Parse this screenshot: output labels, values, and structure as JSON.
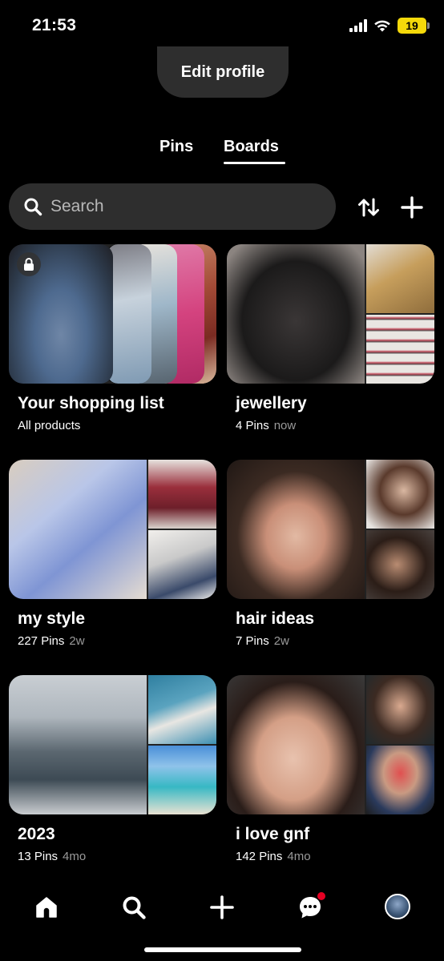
{
  "status_bar": {
    "time": "21:53",
    "battery": "19",
    "icons": [
      "cellular-signal-icon",
      "wifi-icon",
      "battery-icon"
    ]
  },
  "profile": {
    "edit_label": "Edit profile"
  },
  "tabs": [
    {
      "label": "Pins",
      "active": false
    },
    {
      "label": "Boards",
      "active": true
    }
  ],
  "search": {
    "placeholder": "Search",
    "icon": "search-icon"
  },
  "toolbar": {
    "sort_icon": "sort-arrows-icon",
    "add_icon": "plus-icon"
  },
  "boards": [
    {
      "title": "Your shopping list",
      "count": "All products",
      "age": "",
      "private": true
    },
    {
      "title": "jewellery",
      "count": "4 Pins",
      "age": "now"
    },
    {
      "title": "my style",
      "count": "227 Pins",
      "age": "2w"
    },
    {
      "title": "hair ideas",
      "count": "7 Pins",
      "age": "2w"
    },
    {
      "title": "2023",
      "count": "13 Pins",
      "age": "4mo"
    },
    {
      "title": "i love gnf",
      "count": "142 Pins",
      "age": "4mo"
    }
  ],
  "bottom_nav": {
    "items": [
      "home-icon",
      "search-icon",
      "plus-icon",
      "messages-icon",
      "profile-avatar"
    ],
    "messages_notification": true
  },
  "colors": {
    "background": "#000000",
    "surface": "#2e2e2e",
    "notification": "#e60023",
    "battery": "#f5d90a"
  }
}
